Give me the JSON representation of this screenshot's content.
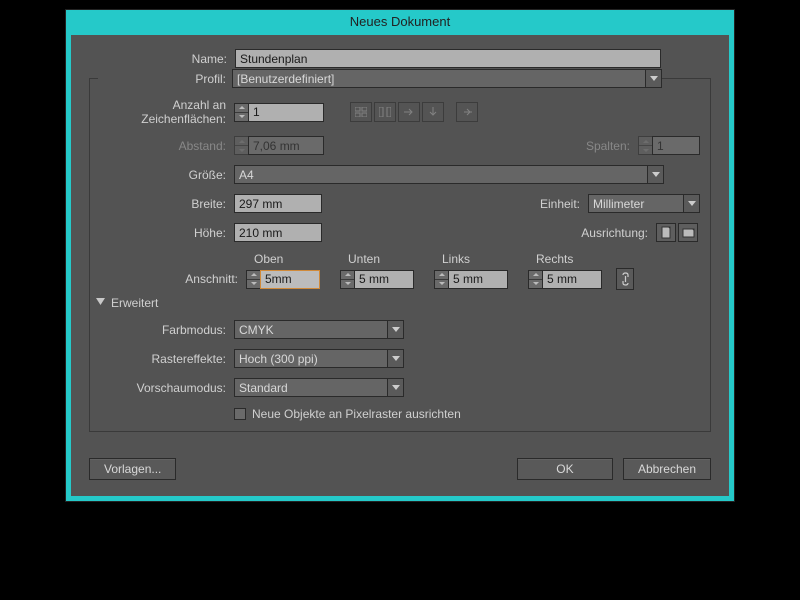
{
  "title": "Neues Dokument",
  "labels": {
    "name": "Name:",
    "profil": "Profil:",
    "artboards": "Anzahl an Zeichenflächen:",
    "abstand": "Abstand:",
    "spalten": "Spalten:",
    "groesse": "Größe:",
    "breite": "Breite:",
    "einheit": "Einheit:",
    "hoehe": "Höhe:",
    "ausrichtung": "Ausrichtung:",
    "anschnitt": "Anschnitt:",
    "erweitert": "Erweitert",
    "farbmodus": "Farbmodus:",
    "raster": "Rastereffekte:",
    "vorschau": "Vorschaumodus:",
    "pixelalign": "Neue Objekte an Pixelraster ausrichten"
  },
  "values": {
    "name": "Stundenplan",
    "profil": "[Benutzerdefiniert]",
    "artboards": "1",
    "abstand": "7,06 mm",
    "spalten": "1",
    "groesse": "A4",
    "breite": "297 mm",
    "einheit": "Millimeter",
    "hoehe": "210 mm",
    "farbmodus": "CMYK",
    "raster": "Hoch (300 ppi)",
    "vorschau": "Standard"
  },
  "bleed": {
    "headers": {
      "oben": "Oben",
      "unten": "Unten",
      "links": "Links",
      "rechts": "Rechts"
    },
    "oben": "5mm",
    "unten": "5 mm",
    "links": "5 mm",
    "rechts": "5 mm"
  },
  "buttons": {
    "vorlagen": "Vorlagen...",
    "ok": "OK",
    "abbrechen": "Abbrechen"
  }
}
